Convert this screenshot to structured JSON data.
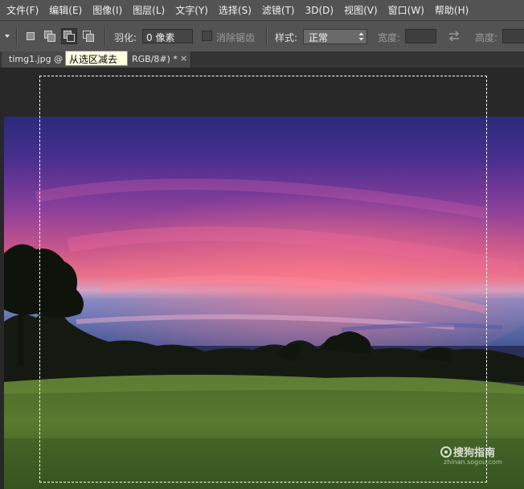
{
  "menu": {
    "items": [
      "文件(F)",
      "编辑(E)",
      "图像(I)",
      "图层(L)",
      "文字(Y)",
      "选择(S)",
      "滤镜(T)",
      "3D(D)",
      "视图(V)",
      "窗口(W)",
      "帮助(H)"
    ]
  },
  "options": {
    "feather_label": "羽化:",
    "feather_value": "0 像素",
    "antialias_label": "消除锯齿",
    "style_label": "样式:",
    "style_value": "正常",
    "width_label": "宽度:",
    "height_label": "高度:",
    "icons": {
      "tool_dropdown": "chevron-down-icon",
      "new_selection": "new-selection-icon",
      "add_selection": "add-to-selection-icon",
      "subtract_selection": "subtract-from-selection-icon",
      "intersect_selection": "intersect-selection-icon",
      "swap": "swap-arrows-icon"
    }
  },
  "tab": {
    "title_left": "timg1.jpg @ ",
    "title_right": "RGB/8#) *",
    "close": "×"
  },
  "tooltip": {
    "text": "从选区减去"
  },
  "watermark": {
    "text": "搜狗指南",
    "sub": "zhinan.sogou.com"
  },
  "colors": {
    "menubar_bg": "#535353",
    "canvas_bg": "#282828",
    "tooltip_bg": "#ffffe1"
  }
}
